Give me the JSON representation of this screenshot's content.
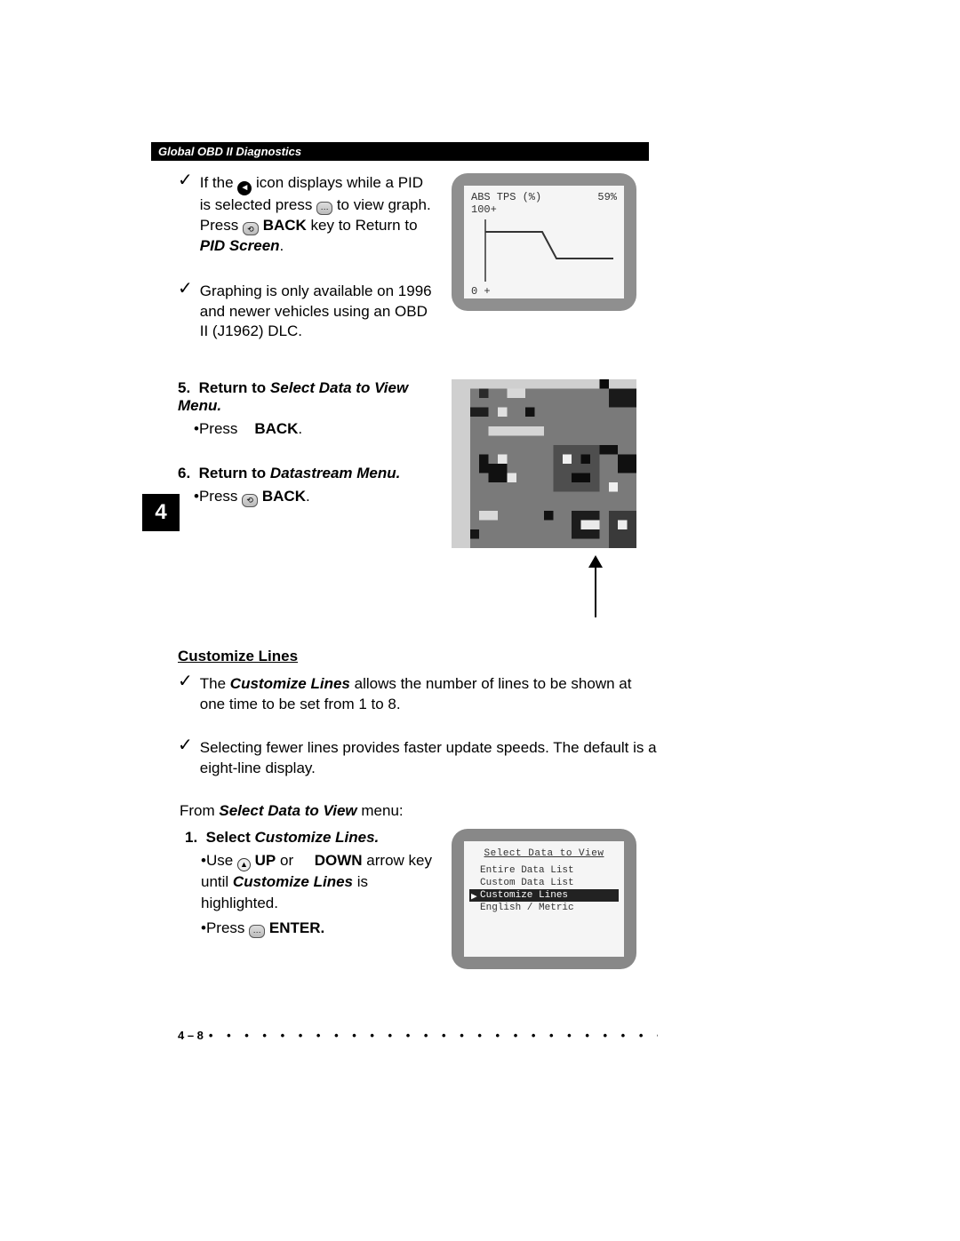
{
  "header": "Global OBD II Diagnostics",
  "chapter_tab": "4",
  "check_items_top": [
    {
      "pre": "If the ",
      "mid1": " icon displays while a PID is selected press ",
      "mid2": "  to view graph. Press ",
      "mid3": " ",
      "back": "BACK",
      "post": " key to Return to ",
      "pid": "PID Screen",
      "end": "."
    },
    {
      "text": "Graphing is only available on 1996 and newer vehicles using an OBD II (J1962) DLC."
    }
  ],
  "fig1": {
    "label": "ABS TPS (%)",
    "value": "59%",
    "y_top": "100+",
    "y_bottom": "0  +"
  },
  "steps_mid": [
    {
      "num": "5.",
      "title_pre": "Return to ",
      "title_em": "Select Data to View Menu.",
      "press": "•Press",
      "back": "BACK",
      "dot": "."
    },
    {
      "num": "6.",
      "title_pre": "Return to ",
      "title_em": "Datastream Menu.",
      "press": "•Press ",
      "back": "BACK",
      "dot": "."
    }
  ],
  "section_head": "Customize Lines",
  "check_items_wide": [
    {
      "pre": "The ",
      "em": "Customize Lines",
      "post": " allows the number of lines to be shown at one time to be set from 1 to 8."
    },
    {
      "text": "Selecting fewer lines provides faster update speeds.  The default is a eight-line display."
    }
  ],
  "from_line": {
    "pre": "From ",
    "em": "Select Data to View",
    "post": " menu:"
  },
  "step_bottom": {
    "num": "1.",
    "title_pre": "Select ",
    "title_em": "Customize Lines.",
    "use_pre": "•Use ",
    "up": "UP",
    "or": " or ",
    "down": "DOWN",
    "arrow_text": " arrow key until ",
    "cl": "Customize Lines",
    "is_h": " is highlighted.",
    "press": "•Press ",
    "enter": "ENTER."
  },
  "fig3": {
    "title": "Select Data to View",
    "items": [
      "Entire Data List",
      "Custom Data List",
      "Customize Lines",
      "English / Metric"
    ],
    "selected_index": 2
  },
  "footer": {
    "page": "4 – 8"
  }
}
